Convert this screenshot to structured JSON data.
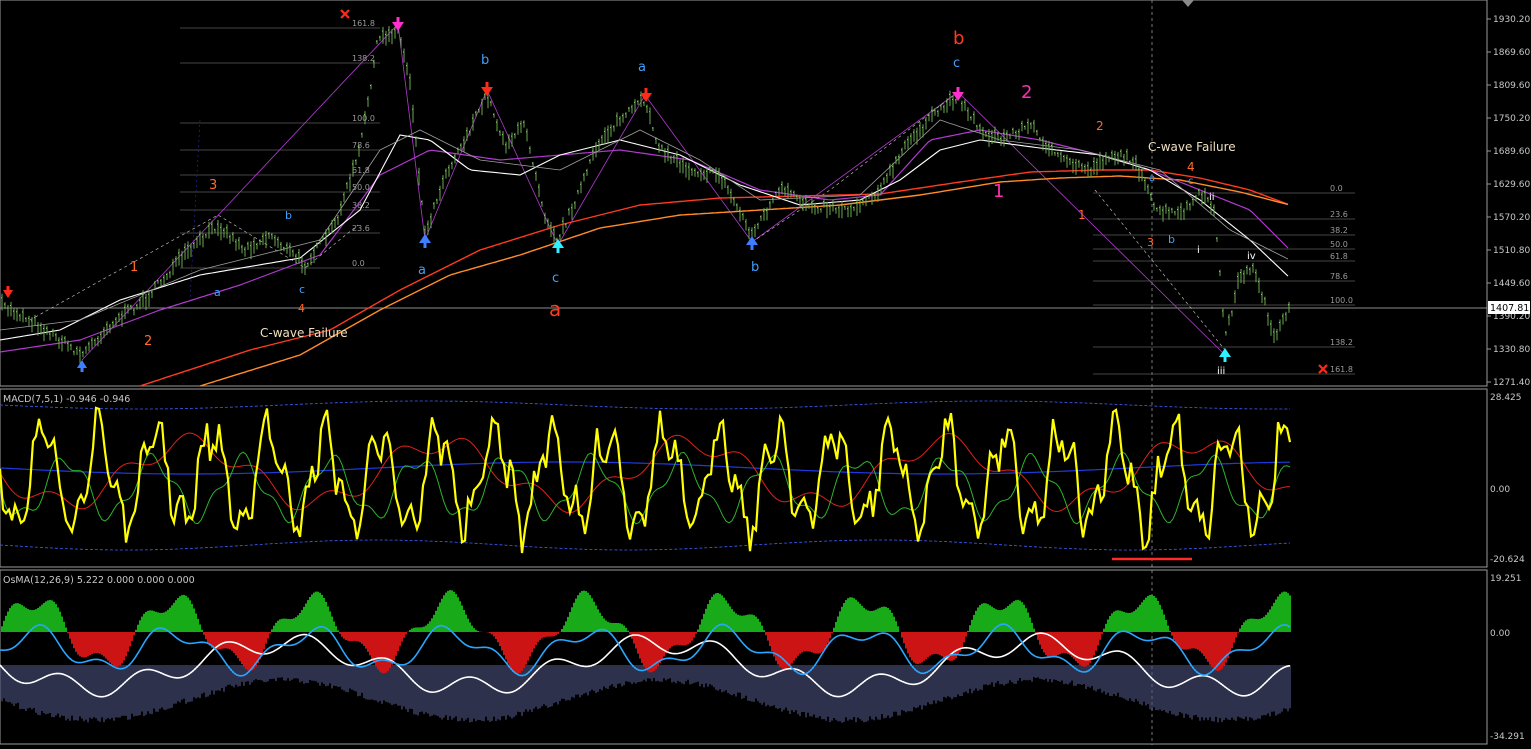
{
  "colors": {
    "background": "#000000",
    "chart_frame": "#9a9a9a",
    "axis_text": "#c8c8c8",
    "price_up": "#6aa84f",
    "price_line": "#8fd36f",
    "ma_white": "#ffffff",
    "ma_grey": "#bdbdbd",
    "ma_purple": "#b23bd1",
    "ma_orange": "#ff8c28",
    "ma_red": "#ff3b1f",
    "fib": "#5d5d5d",
    "fib_text": "#9a9a9a",
    "macd_yellow": "#ffff00",
    "macd_green": "#2bb52b",
    "macd_red": "#e0201a",
    "macd_blue": "#1f3be0",
    "osma_green": "#1fd61f",
    "osma_red": "#ff1a1a",
    "osma_white": "#ffffff",
    "osma_cyan": "#2aa6ff",
    "osma_hist": "#9aa4ff",
    "wave_red": "#ff3b1f",
    "wave_blue": "#3fa0ff",
    "wave_orange": "#ff6a2a",
    "wave_magenta": "#ff2fb4",
    "label_cream": "#f0e0c0"
  },
  "price_panel": {
    "axis_labels": [
      "1930.20",
      "1869.60",
      "1809.60",
      "1750.20",
      "1689.60",
      "1629.60",
      "1570.20",
      "1510.80",
      "1449.60",
      "1390.20",
      "1330.80",
      "1271.40"
    ],
    "current_price": "1407.81",
    "annotations": {
      "cwave_left": "C-wave Failure",
      "cwave_right": "C-wave Failure",
      "big_a": "a",
      "big_b": "b",
      "big_2": "2",
      "big_1": "1",
      "w1": "1",
      "w2": "2",
      "w3": "3",
      "w4": "4",
      "a1": "a",
      "b1": "b",
      "c1": "c",
      "a2": "a",
      "b2": "b",
      "c2": "c",
      "a3": "a",
      "b3": "b",
      "c3": "c",
      "r1": "1",
      "r2": "2",
      "r3": "3",
      "r4": "4",
      "ri": "i",
      "rii": "ii",
      "riii": "iii",
      "riv": "iv",
      "ra": "a",
      "rb": "b",
      "rc": "c"
    },
    "fib_left": [
      "161.8",
      "138.2",
      "100.0",
      "78.6",
      "61.8",
      "50.0",
      "38.2",
      "23.6",
      "0.0"
    ],
    "fib_right": [
      "0.0",
      "23.6",
      "38.2",
      "50.0",
      "61.8",
      "78.6",
      "100.0",
      "138.2",
      "161.8"
    ]
  },
  "macd_panel": {
    "title": "MACD(7,5,1) -0.946 -0.946",
    "axis_labels": [
      "28.425",
      "0.00",
      "-20.624"
    ]
  },
  "osma_panel": {
    "title": "OsMA(12,26,9) 5.222 0.000 0.000 0.000",
    "axis_labels": [
      "19.251",
      "0.00",
      "-34.291"
    ]
  }
}
